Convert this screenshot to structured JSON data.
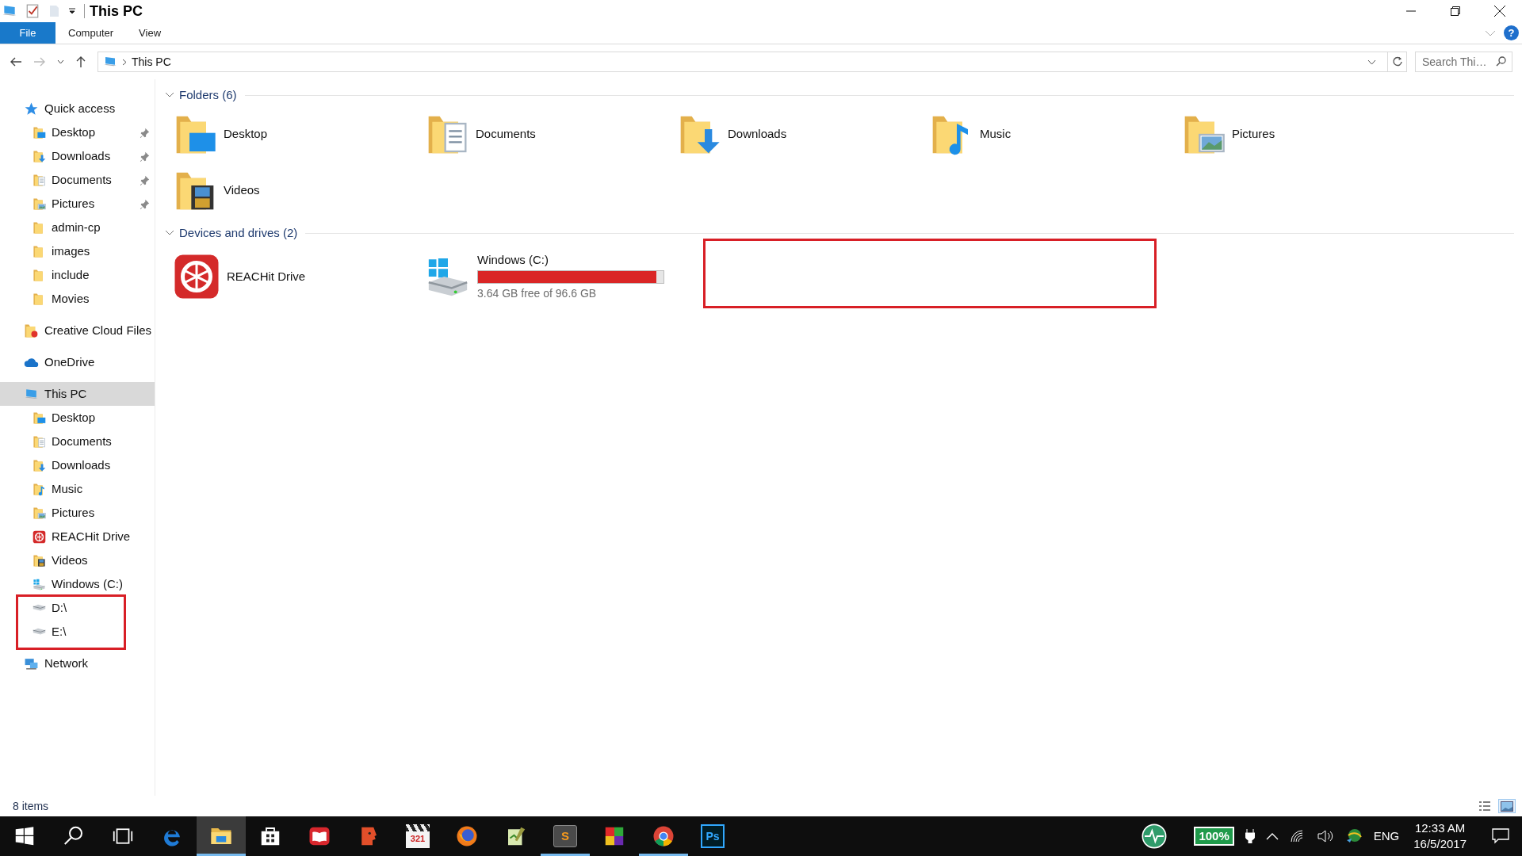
{
  "window": {
    "title": "This PC"
  },
  "ribbon": {
    "tabs": [
      {
        "label": "File",
        "kind": "menu"
      },
      {
        "label": "Computer",
        "kind": "tab"
      },
      {
        "label": "View",
        "kind": "tab"
      }
    ],
    "help": "?"
  },
  "address": {
    "path": [
      "This PC"
    ]
  },
  "search": {
    "placeholder": "Search Thi…"
  },
  "sidebar": {
    "items": [
      {
        "label": "Quick access",
        "kind": "star",
        "selected": false,
        "children": [
          {
            "label": "Desktop",
            "kind": "desktop",
            "selected": false,
            "pinned": true
          },
          {
            "label": "Downloads",
            "kind": "downloads",
            "selected": false,
            "pinned": true
          },
          {
            "label": "Documents",
            "kind": "documents",
            "selected": false,
            "pinned": true
          },
          {
            "label": "Pictures",
            "kind": "pictures",
            "selected": false,
            "pinned": true
          },
          {
            "label": "admin-cp",
            "kind": "folder",
            "selected": false,
            "pinned": false
          },
          {
            "label": "images",
            "kind": "folder",
            "selected": false,
            "pinned": false
          },
          {
            "label": "include",
            "kind": "folder",
            "selected": false,
            "pinned": false
          },
          {
            "label": "Movies",
            "kind": "folder",
            "selected": false,
            "pinned": false
          }
        ]
      },
      {
        "label": "Creative Cloud Files",
        "kind": "creative",
        "selected": false
      },
      {
        "label": "OneDrive",
        "kind": "cloud",
        "selected": false
      },
      {
        "label": "This PC",
        "kind": "pc",
        "selected": true,
        "children": [
          {
            "label": "Desktop",
            "kind": "desktop",
            "selected": false
          },
          {
            "label": "Documents",
            "kind": "documents",
            "selected": false
          },
          {
            "label": "Downloads",
            "kind": "downloads",
            "selected": false
          },
          {
            "label": "Music",
            "kind": "music",
            "selected": false
          },
          {
            "label": "Pictures",
            "kind": "pictures",
            "selected": false
          },
          {
            "label": "REACHit Drive",
            "kind": "app",
            "selected": false
          },
          {
            "label": "Videos",
            "kind": "videos",
            "selected": false
          },
          {
            "label": "Windows (C:)",
            "kind": "windrive",
            "selected": false
          },
          {
            "label": "D:\\",
            "kind": "drive",
            "selected": false
          },
          {
            "label": "E:\\",
            "kind": "drive",
            "selected": false
          }
        ]
      },
      {
        "label": "Network",
        "kind": "network",
        "selected": false
      }
    ]
  },
  "sections": [
    {
      "title": "Folders (6)",
      "expanded": true,
      "items": [
        {
          "label": "Desktop",
          "kind": "desktop"
        },
        {
          "label": "Documents",
          "kind": "documents"
        },
        {
          "label": "Downloads",
          "kind": "downloads"
        },
        {
          "label": "Music",
          "kind": "music"
        },
        {
          "label": "Pictures",
          "kind": "pictures"
        },
        {
          "label": "Videos",
          "kind": "videos"
        }
      ]
    },
    {
      "title": "Devices and drives (2)",
      "expanded": true,
      "items": [
        {
          "label": "REACHit Drive",
          "kind": "app"
        },
        {
          "label": "Windows (C:)",
          "kind": "windrive",
          "level": 0.962,
          "reading": "3.64 GB free of 96.6 GB"
        }
      ]
    }
  ],
  "status_bar": {
    "text": "8 items",
    "view_modes": [
      {
        "kind": "details",
        "selected": false
      },
      {
        "kind": "tiles",
        "selected": true
      }
    ]
  },
  "taskbar": {
    "items": [
      {
        "kind": "start",
        "selected": false,
        "open": false
      },
      {
        "kind": "search",
        "selected": false,
        "open": false
      },
      {
        "kind": "taskview",
        "selected": false,
        "open": false
      },
      {
        "kind": "edge",
        "selected": false,
        "open": false
      },
      {
        "kind": "explorer",
        "selected": true,
        "open": true
      },
      {
        "kind": "store",
        "selected": false,
        "open": false
      },
      {
        "kind": "book",
        "selected": false,
        "open": false
      },
      {
        "kind": "face",
        "selected": false,
        "open": false
      },
      {
        "kind": "clapper",
        "label": "321",
        "selected": false,
        "open": false
      },
      {
        "kind": "firefox",
        "selected": false,
        "open": false
      },
      {
        "kind": "notepad",
        "selected": false,
        "open": false
      },
      {
        "kind": "sublime",
        "label": "S",
        "selected": false,
        "open": true
      },
      {
        "kind": "tiles",
        "selected": false,
        "open": false
      },
      {
        "kind": "chrome",
        "selected": false,
        "open": true
      },
      {
        "kind": "ps",
        "label": "Ps",
        "selected": false,
        "open": false
      }
    ],
    "battery": "100%",
    "language": "ENG",
    "time": "12:33 AM",
    "date": "16/5/2017"
  }
}
